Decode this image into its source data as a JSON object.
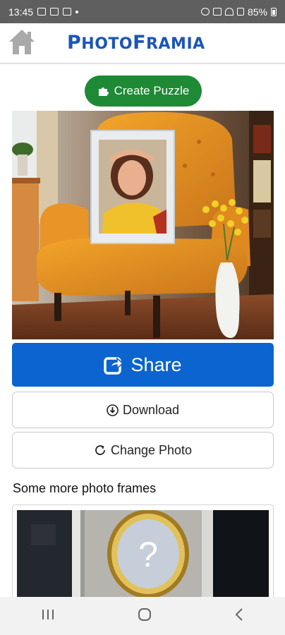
{
  "status_bar": {
    "time": "13:45",
    "battery": "85%"
  },
  "header": {
    "logo_first": "P",
    "logo_rest1": "HOTO",
    "logo_f": "F",
    "logo_rest2": "RAMIA"
  },
  "actions": {
    "create_puzzle": "Create Puzzle",
    "share": "Share",
    "download": "Download",
    "change_photo": "Change Photo"
  },
  "more_frames": {
    "title": "Some more photo frames",
    "placeholder_mark": "?"
  },
  "colors": {
    "brand": "#1b55b8",
    "share": "#0b64cf",
    "puzzle": "#1e8a35"
  }
}
